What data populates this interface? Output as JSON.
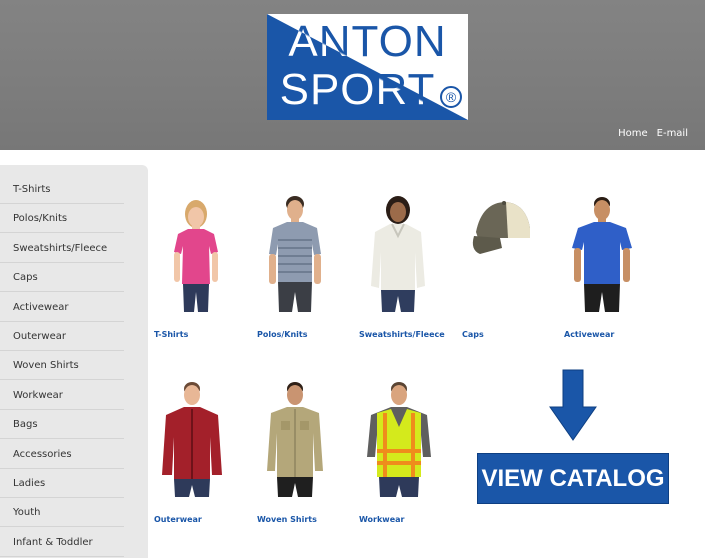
{
  "brand": {
    "logo_line1": "ANTON",
    "logo_line2": "SPORT",
    "registered_mark": "®",
    "color": "#1a56a8"
  },
  "topnav": {
    "home": "Home",
    "email": "E-mail"
  },
  "sidebar": {
    "items": [
      {
        "label": "T-Shirts"
      },
      {
        "label": "Polos/Knits"
      },
      {
        "label": "Sweatshirts/Fleece"
      },
      {
        "label": "Caps"
      },
      {
        "label": "Activewear"
      },
      {
        "label": "Outerwear"
      },
      {
        "label": "Woven Shirts"
      },
      {
        "label": "Workwear"
      },
      {
        "label": "Bags"
      },
      {
        "label": "Accessories"
      },
      {
        "label": "Ladies"
      },
      {
        "label": "Youth"
      },
      {
        "label": "Infant & Toddler"
      }
    ]
  },
  "products": [
    {
      "label": "T-Shirts",
      "icon": "pink-tshirt-model-image"
    },
    {
      "label": "Polos/Knits",
      "icon": "gray-polo-model-image"
    },
    {
      "label": "Sweatshirts/Fleece",
      "icon": "cream-sweater-model-image"
    },
    {
      "label": "Caps",
      "icon": "trucker-cap-image"
    },
    {
      "label": "Activewear",
      "icon": "blue-activewear-model-image"
    },
    {
      "label": "Outerwear",
      "icon": "red-fleece-jacket-model-image"
    },
    {
      "label": "Woven Shirts",
      "icon": "khaki-woven-shirt-model-image"
    },
    {
      "label": "Workwear",
      "icon": "hi-vis-vest-model-image"
    }
  ],
  "catalog": {
    "button_label": "VIEW CATALOG",
    "arrow_icon": "down-arrow-icon"
  }
}
